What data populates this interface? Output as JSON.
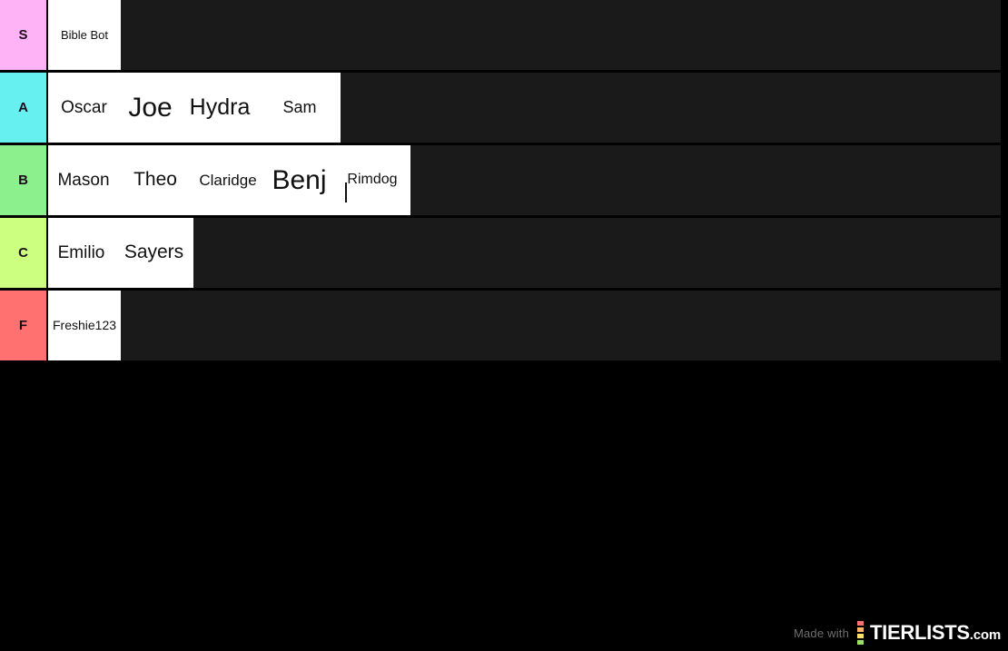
{
  "page": {
    "background_color": "#000000",
    "row_background_color": "#1a1a1a",
    "item_background_color": "#ffffff",
    "item_text_color": "#111111"
  },
  "tiers": [
    {
      "label": "S",
      "color": "#ffb3f7",
      "items": [
        {
          "text": "Bible Bot",
          "font_size": 13,
          "width": 80,
          "editing": false
        }
      ]
    },
    {
      "label": "A",
      "color": "#66f0f0",
      "items": [
        {
          "text": "Oscar",
          "font_size": 19,
          "width": 79,
          "editing": false
        },
        {
          "text": "Joe",
          "font_size": 30,
          "width": 67,
          "editing": false
        },
        {
          "text": "Hydra",
          "font_size": 25,
          "width": 86,
          "editing": false
        },
        {
          "text": "Sam",
          "font_size": 18,
          "width": 90,
          "editing": false
        }
      ]
    },
    {
      "label": "B",
      "color": "#8cf08c",
      "items": [
        {
          "text": "Mason",
          "font_size": 19,
          "width": 78,
          "editing": false
        },
        {
          "text": "Theo",
          "font_size": 21,
          "width": 80,
          "editing": false
        },
        {
          "text": "Claridge",
          "font_size": 17,
          "width": 80,
          "editing": false
        },
        {
          "text": "Benj",
          "font_size": 30,
          "width": 77,
          "editing": false
        },
        {
          "text": "Rimdog",
          "font_size": 16,
          "width": 84,
          "editing": true
        }
      ]
    },
    {
      "label": "C",
      "color": "#ccff80",
      "items": [
        {
          "text": "Emilio",
          "font_size": 19,
          "width": 73,
          "editing": false
        },
        {
          "text": "Sayers",
          "font_size": 21,
          "width": 87,
          "editing": false
        }
      ]
    },
    {
      "label": "F",
      "color": "#ff7070",
      "items": [
        {
          "text": "Freshie123",
          "font_size": 14,
          "width": 80,
          "editing": false
        }
      ]
    }
  ],
  "watermark": {
    "made_with": "Made with",
    "brand": "TIERLISTS",
    "domain": ".com",
    "logo_colors": [
      "#ff7070",
      "#ffb366",
      "#ffe066",
      "#9be066"
    ]
  }
}
